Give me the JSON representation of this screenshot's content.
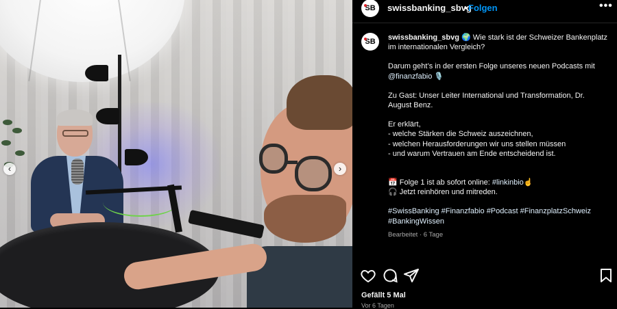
{
  "post": {
    "photo_alt": "Podcast-Aufnahme",
    "nav_prev": "‹",
    "nav_next": "›"
  },
  "header": {
    "avatar_text": "SB",
    "username": "swissbanking_sbvg",
    "separator": "•",
    "follow_label": "Folgen",
    "more_label": "•••"
  },
  "caption": {
    "avatar_text": "SB",
    "username": "swissbanking_sbvg",
    "line1_after_user": " 🌍 Wie stark ist der Schweizer Bankenplatz im internationalen Vergleich?",
    "para2_text": "Darum geht’s in der ersten Folge unseres neuen Podcasts mit ",
    "para2_mention": "@finanzfabio",
    "para2_emoji": " 🎙️",
    "para3": "Zu Gast: Unser Leiter International und Transformation, Dr. August Benz.",
    "para4_lines": [
      "Er erklärt,",
      "- welche Stärken die Schweiz auszeichnen,",
      "- welchen Herausforderungen wir uns stellen müssen",
      "- und warum Vertrauen am Ende entscheidend ist."
    ],
    "para5_line1_text": "📅 Folge 1 ist ab sofort online: ",
    "para5_line1_link": "#linkinbio",
    "para5_line1_emoji": "☝️",
    "para5_line2": "🎧 Jetzt reinhören und mitreden.",
    "hashtags": "#SwissBanking #Finanzfabio #Podcast #FinanzplatzSchweiz #BankingWissen",
    "meta": "Bearbeitet · 6 Tage"
  },
  "actions": {
    "icons": [
      "heart-icon",
      "comment-icon",
      "share-icon",
      "bookmark-icon"
    ]
  },
  "footer": {
    "likes": "Gefällt 5 Mal",
    "time": "Vor 6 Tagen"
  },
  "colors": {
    "accent": "#0095f6",
    "background": "#000000",
    "text": "#f5f5f5",
    "muted": "#a8a8a8"
  }
}
